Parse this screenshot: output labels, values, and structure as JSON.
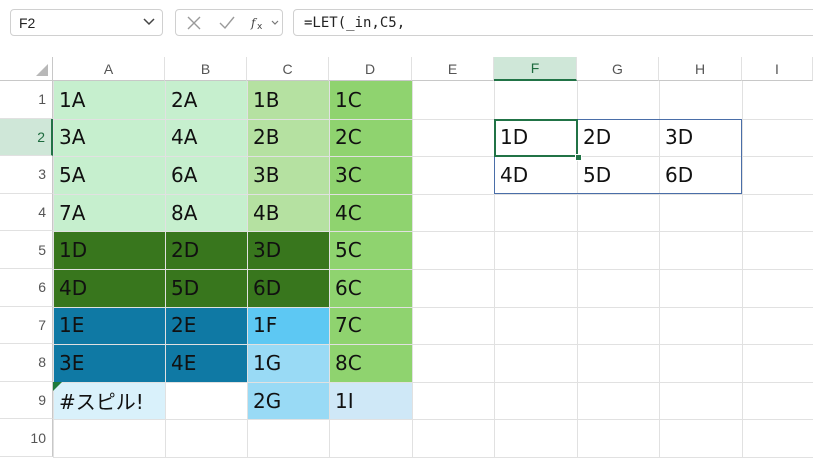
{
  "formula_bar": {
    "name_box": "F2",
    "formula": "=LET(_in,C5,",
    "icons": [
      "cancel-x-icon",
      "enter-check-icon",
      "function-fx-icon",
      "chevron-down-icon"
    ]
  },
  "columns": [
    "A",
    "B",
    "C",
    "D",
    "E",
    "F",
    "G",
    "H",
    "I"
  ],
  "rows": [
    "1",
    "2",
    "3",
    "4",
    "5",
    "6",
    "7",
    "8",
    "9",
    "10"
  ],
  "selected": {
    "column": "F",
    "row": "2"
  },
  "colors": {
    "light_green": "#c6efce",
    "mid_green": "#b5e1a1",
    "green": "#8fd36f",
    "dark_green": "#38761d",
    "teal_blue": "#0f79a4",
    "sky_blue": "#5dc8f3",
    "light_blue": "#99daf5",
    "pale_blue": "#cfe8f7",
    "selection": "#217346",
    "spill_border": "#4a6ea8"
  },
  "cells": {
    "A1": "1A",
    "B1": "2A",
    "C1": "1B",
    "D1": "1C",
    "A2": "3A",
    "B2": "4A",
    "C2": "2B",
    "D2": "2C",
    "A3": "5A",
    "B3": "6A",
    "C3": "3B",
    "D3": "3C",
    "A4": "7A",
    "B4": "8A",
    "C4": "4B",
    "D4": "4C",
    "A5": "1D",
    "B5": "2D",
    "C5": "3D",
    "D5": "5C",
    "A6": "4D",
    "B6": "5D",
    "C6": "6D",
    "D6": "6C",
    "A7": "1E",
    "B7": "2E",
    "C7": "1F",
    "D7": "7C",
    "A8": "3E",
    "B8": "4E",
    "C8": "1G",
    "D8": "8C",
    "A9": "#スピル!",
    "C9": "2G",
    "D9": "1I",
    "F2": "1D",
    "G2": "2D",
    "H2": "3D",
    "F3": "4D",
    "G3": "5D",
    "H3": "6D"
  }
}
